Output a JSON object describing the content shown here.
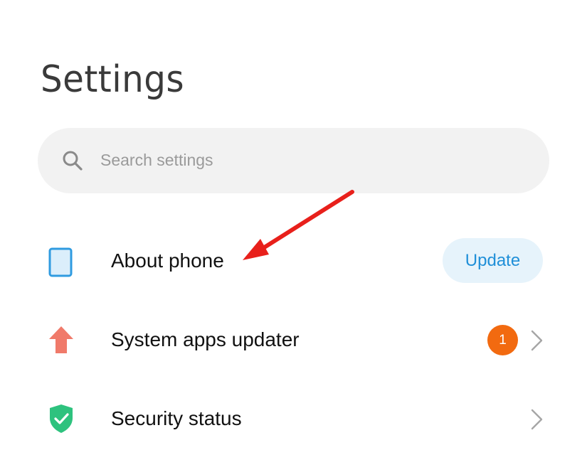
{
  "page": {
    "title": "Settings"
  },
  "search": {
    "placeholder": "Search settings",
    "icon": "search-icon"
  },
  "rows": [
    {
      "label": "About phone",
      "icon": "phone-outline-icon",
      "icon_color": "#2f9be0",
      "action_label": "Update",
      "action_color": "#1f8fd8",
      "action_bg": "#e6f3fb"
    },
    {
      "label": "System apps updater",
      "icon": "up-arrow-icon",
      "icon_color": "#f07a6a",
      "badge_count": "1",
      "badge_color": "#f26a10",
      "chevron": "chevron-right-icon"
    },
    {
      "label": "Security status",
      "icon": "shield-check-icon",
      "icon_color": "#2ec27e",
      "chevron": "chevron-right-icon"
    }
  ],
  "annotation": {
    "icon": "red-arrow-annotation",
    "color": "#e8201b"
  }
}
